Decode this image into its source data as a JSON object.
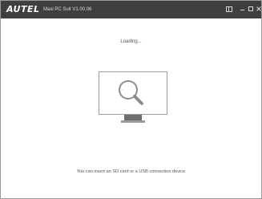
{
  "titlebar": {
    "logo": "AUTEL",
    "title": "Maxi PC Suit V1.00.06"
  },
  "main": {
    "status": "Loading...",
    "hint": "You can insert an SD card or a USB connection device"
  },
  "icons": {
    "settings": "settings-icon",
    "minimize": "minimize-icon",
    "maximize": "maximize-icon",
    "close": "close-icon",
    "monitor": "monitor-icon",
    "search": "search-icon"
  },
  "colors": {
    "titlebar": "#3f3f41",
    "accent": "#9b9b9b",
    "stand": "#6d6d6d"
  }
}
